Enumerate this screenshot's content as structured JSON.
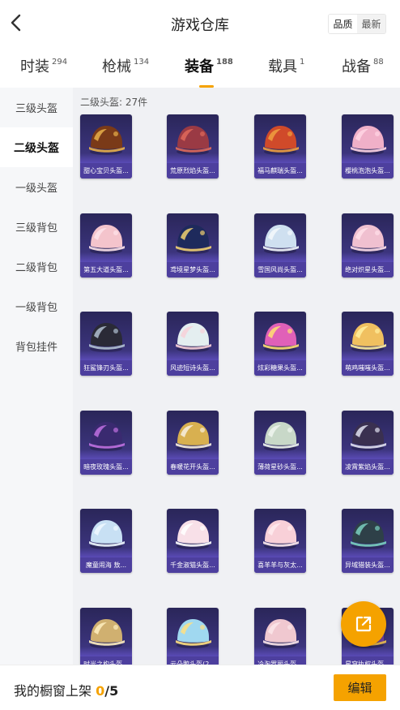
{
  "header": {
    "title": "游戏仓库",
    "toggle": {
      "option_quality": "品质",
      "option_latest": "最新",
      "selected": "品质"
    }
  },
  "tabs": [
    {
      "label": "时装",
      "count": "294",
      "active": false
    },
    {
      "label": "枪械",
      "count": "134",
      "active": false
    },
    {
      "label": "装备",
      "count": "188",
      "active": true
    },
    {
      "label": "载具",
      "count": "1",
      "active": false
    },
    {
      "label": "战备",
      "count": "88",
      "active": false
    }
  ],
  "sidebar": {
    "items": [
      {
        "label": "三级头盔",
        "active": false
      },
      {
        "label": "二级头盔",
        "active": true
      },
      {
        "label": "一级头盔",
        "active": false
      },
      {
        "label": "三级背包",
        "active": false
      },
      {
        "label": "二级背包",
        "active": false
      },
      {
        "label": "一级背包",
        "active": false
      },
      {
        "label": "背包挂件",
        "active": false
      }
    ]
  },
  "section": {
    "label": "二级头盔: 27件"
  },
  "items": [
    {
      "name": "甜心宝贝头盔...",
      "color": "#7a3a18",
      "accent": "#e8b04a"
    },
    {
      "name": "荒原烈焰头盔...",
      "color": "#9a3a44",
      "accent": "#e06a5a"
    },
    {
      "name": "福马麒瑞头盔...",
      "color": "#d04a2a",
      "accent": "#f0a040"
    },
    {
      "name": "樱桃泡泡头盔...",
      "color": "#f0b0c8",
      "accent": "#ffd6e4"
    },
    {
      "name": "第五大道头盔...",
      "color": "#f4c4cc",
      "accent": "#fde4ea"
    },
    {
      "name": "鸢境星梦头盔...",
      "color": "#1e2a5c",
      "accent": "#f0d070"
    },
    {
      "name": "雪国风尚头盔...",
      "color": "#cfe0f0",
      "accent": "#f4f8fc"
    },
    {
      "name": "绝对炽星头盔...",
      "color": "#f0c0d0",
      "accent": "#ffe0ea"
    },
    {
      "name": "狂鲨锋刃头盔...",
      "color": "#2a2a36",
      "accent": "#b0c0d0"
    },
    {
      "name": "风迹短诗头盔...",
      "color": "#e4eef0",
      "accent": "#f8d0d8"
    },
    {
      "name": "炫彩糖果头盔...",
      "color": "#e060b8",
      "accent": "#ffe070"
    },
    {
      "name": "萌鸡嗤嗤头盔...",
      "color": "#f0c060",
      "accent": "#fff0a0"
    },
    {
      "name": "暗夜玫瑰头盔...",
      "color": "#3a2a70",
      "accent": "#c070e0"
    },
    {
      "name": "春暖花开头盔...",
      "color": "#d8b050",
      "accent": "#f8f0e0"
    },
    {
      "name": "薄荷星砂头盔...",
      "color": "#c8d8c8",
      "accent": "#f0f6f0"
    },
    {
      "name": "凌霄紫焰头盔...",
      "color": "#3a3050",
      "accent": "#e0e0f0"
    },
    {
      "name": "魔童闹海 敖...",
      "color": "#c8e0f4",
      "accent": "#f0f8ff"
    },
    {
      "name": "千金淑猫头盔...",
      "color": "#f8e0e8",
      "accent": "#ffffff"
    },
    {
      "name": "喜羊羊与灰太...",
      "color": "#f8d0d8",
      "accent": "#ffecf0"
    },
    {
      "name": "异域猎装头盔...",
      "color": "#2e4048",
      "accent": "#7ad0c0"
    },
    {
      "name": "时光之构头盔...",
      "color": "#d0b070",
      "accent": "#fff0c0"
    },
    {
      "name": "云朵鸭头盔(2...",
      "color": "#a0d8f0",
      "accent": "#ffe080"
    },
    {
      "name": "冷淘罗丽头盔...",
      "color": "#f0c8d0",
      "accent": "#fbe6ea"
    },
    {
      "name": "星穹执权头盔...",
      "color": "#7040a0",
      "accent": "#f0c050"
    }
  ],
  "bottom": {
    "shelf_label": "我的橱窗上架 ",
    "shelf_current": "0",
    "shelf_total": "/5",
    "edit_label": "编辑"
  },
  "colors": {
    "accent": "#f5a200",
    "card_bg": "#2a2659",
    "card_label_bg": "#4d3f9e"
  }
}
